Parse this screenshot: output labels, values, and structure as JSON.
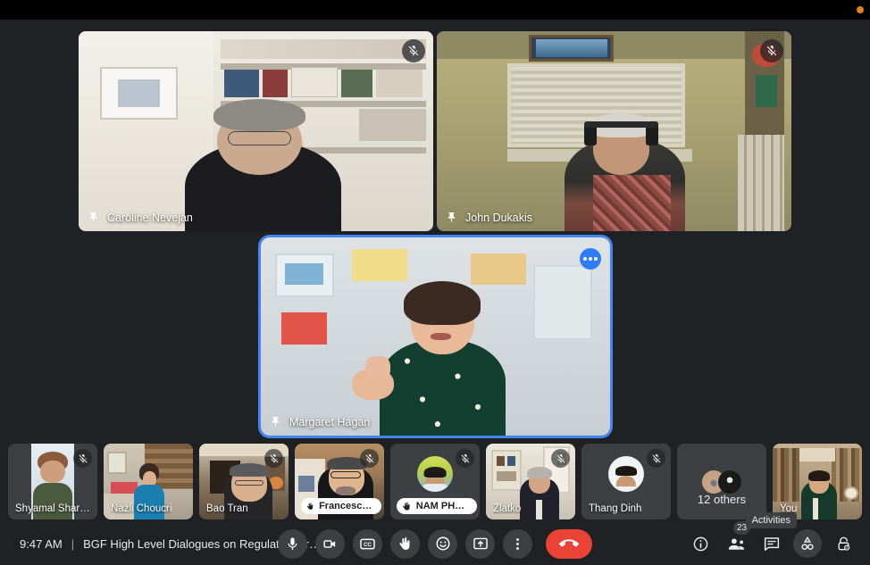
{
  "meta": {
    "recording_indicator": "recording-dot",
    "accent_blue": "#4285f4",
    "end_call_red": "#ea4335",
    "bg": "#202124",
    "tile_bg": "#3c4043"
  },
  "stage": {
    "tiles": [
      {
        "name": "Caroline Nevejan",
        "pinned": true,
        "muted": true,
        "speaking": false
      },
      {
        "name": "John Dukakis",
        "pinned": true,
        "muted": true,
        "speaking": false
      },
      {
        "name": "Margaret Hagan",
        "pinned": true,
        "muted": false,
        "speaking": true,
        "more_options": "more-options"
      }
    ]
  },
  "filmstrip": {
    "tiles": [
      {
        "name": "Shyamal Sharma",
        "muted": true,
        "hand_raised": false,
        "avatar_only": false
      },
      {
        "name": "Nazli Choucri",
        "muted": false,
        "hand_raised": false,
        "avatar_only": false
      },
      {
        "name": "Bao Tran",
        "muted": true,
        "hand_raised": false,
        "avatar_only": false
      },
      {
        "name": "Francesco L...",
        "muted": true,
        "hand_raised": true,
        "avatar_only": false
      },
      {
        "name": "NAM PHAM",
        "muted": true,
        "hand_raised": true,
        "avatar_only": true
      },
      {
        "name": "Zlatko",
        "muted": true,
        "hand_raised": false,
        "avatar_only": false
      },
      {
        "name": "Thang Dinh",
        "muted": true,
        "hand_raised": false,
        "avatar_only": true
      },
      {
        "name": "12 others",
        "overflow": true
      },
      {
        "name": "You",
        "muted": false,
        "hand_raised": false,
        "avatar_only": false
      }
    ]
  },
  "bottom_bar": {
    "time": "9:47 AM",
    "separator": "|",
    "meeting_title": "BGF High Level Dialogues on Regulation Frame…",
    "controls": [
      {
        "id": "microphone",
        "label": "Microphone",
        "icon": "microphone-icon"
      },
      {
        "id": "camera",
        "label": "Camera",
        "icon": "camera-icon"
      },
      {
        "id": "captions",
        "label": "Captions",
        "icon": "cc-icon"
      },
      {
        "id": "raise-hand",
        "label": "Raise hand",
        "icon": "hand-icon"
      },
      {
        "id": "reactions",
        "label": "Reactions",
        "icon": "emoji-icon"
      },
      {
        "id": "present",
        "label": "Present now",
        "icon": "present-screen-icon"
      },
      {
        "id": "more",
        "label": "More options",
        "icon": "more-vertical-icon"
      }
    ],
    "end_call_label": "Leave call",
    "right_controls": [
      {
        "id": "info",
        "label": "Meeting details",
        "icon": "info-icon",
        "badge": null,
        "active": false
      },
      {
        "id": "people",
        "label": "People",
        "icon": "people-icon",
        "badge": "23",
        "active": false
      },
      {
        "id": "chat",
        "label": "Chat",
        "icon": "chat-icon",
        "badge": null,
        "active": false
      },
      {
        "id": "activities",
        "label": "Activities",
        "icon": "activities-icon",
        "badge": null,
        "active": true
      },
      {
        "id": "host",
        "label": "Host controls",
        "icon": "lock-icon",
        "badge": null,
        "active": false
      }
    ],
    "tooltip": "Activities"
  }
}
